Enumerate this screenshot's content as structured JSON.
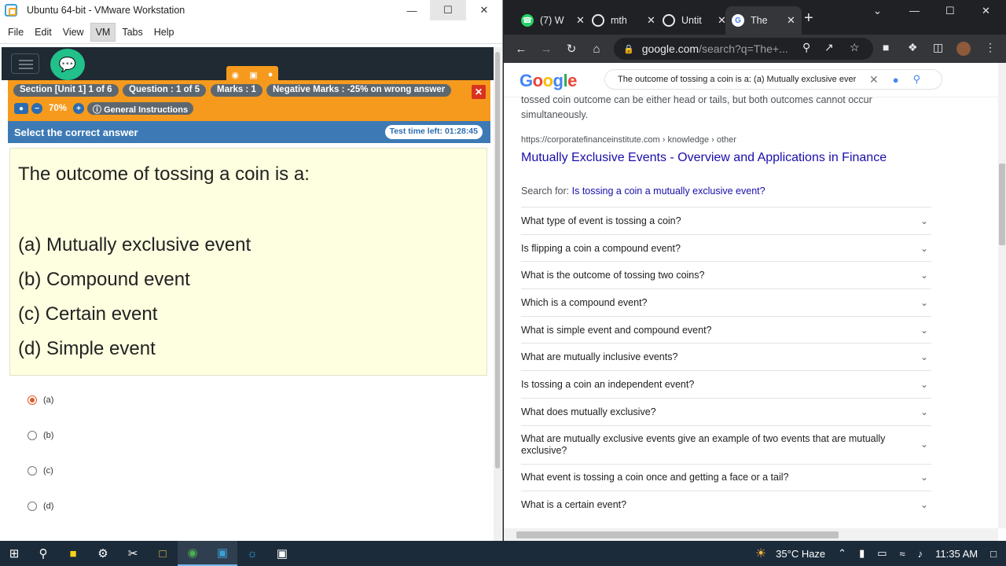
{
  "vmware": {
    "title": "Ubuntu 64-bit - VMware Workstation",
    "menu": [
      "File",
      "Edit",
      "View",
      "VM",
      "Tabs",
      "Help"
    ],
    "active_menu": "VM"
  },
  "exam": {
    "section": "Section [Unit 1] 1 of 6",
    "question_num": "Question : 1 of 5",
    "marks": "Marks : 1",
    "negative": "Negative Marks : -25% on wrong answer",
    "zoom": "70%",
    "instructions": "General Instructions",
    "select_label": "Select the correct answer",
    "timer": "Test time left: 01:28:45",
    "question": "The outcome of tossing a coin is a:",
    "options": [
      "(a) Mutually exclusive event",
      "(b) Compound event",
      "(c) Certain event",
      "(d) Simple event"
    ],
    "answers": [
      "(a)",
      "(b)",
      "(c)",
      "(d)"
    ],
    "selected_answer": "(a)"
  },
  "chrome": {
    "tabs": [
      {
        "title": "(7) W",
        "icon": "whatsapp-icon"
      },
      {
        "title": "mth",
        "icon": "globe-icon"
      },
      {
        "title": "Untit",
        "icon": "globe-icon"
      },
      {
        "title": "The",
        "icon": "google-icon"
      }
    ],
    "url_main": "google.com",
    "url_rest": "/search?q=The+...",
    "search_query": "The outcome of tossing a coin is a: (a) Mutually exclusive ever",
    "snippet": "tossed coin outcome can be either head or tails, but both outcomes cannot occur simultaneously.",
    "result_cite": "https://corporatefinanceinstitute.com › knowledge › other",
    "result_title": "Mutually Exclusive Events - Overview and Applications in Finance",
    "search_for_label": "Search for: ",
    "search_for_link": "Is tossing a coin a mutually exclusive event?",
    "paa": [
      "What type of event is tossing a coin?",
      "Is flipping a coin a compound event?",
      "What is the outcome of tossing two coins?",
      "Which is a compound event?",
      "What is simple event and compound event?",
      "What are mutually inclusive events?",
      "Is tossing a coin an independent event?",
      "What does mutually exclusive?",
      "What are mutually exclusive events give an example of two events that are mutually exclusive?",
      "What event is tossing a coin once and getting a face or a tail?",
      "What is a certain event?"
    ]
  },
  "taskbar": {
    "weather": "35°C  Haze",
    "time": "11:35 AM"
  }
}
